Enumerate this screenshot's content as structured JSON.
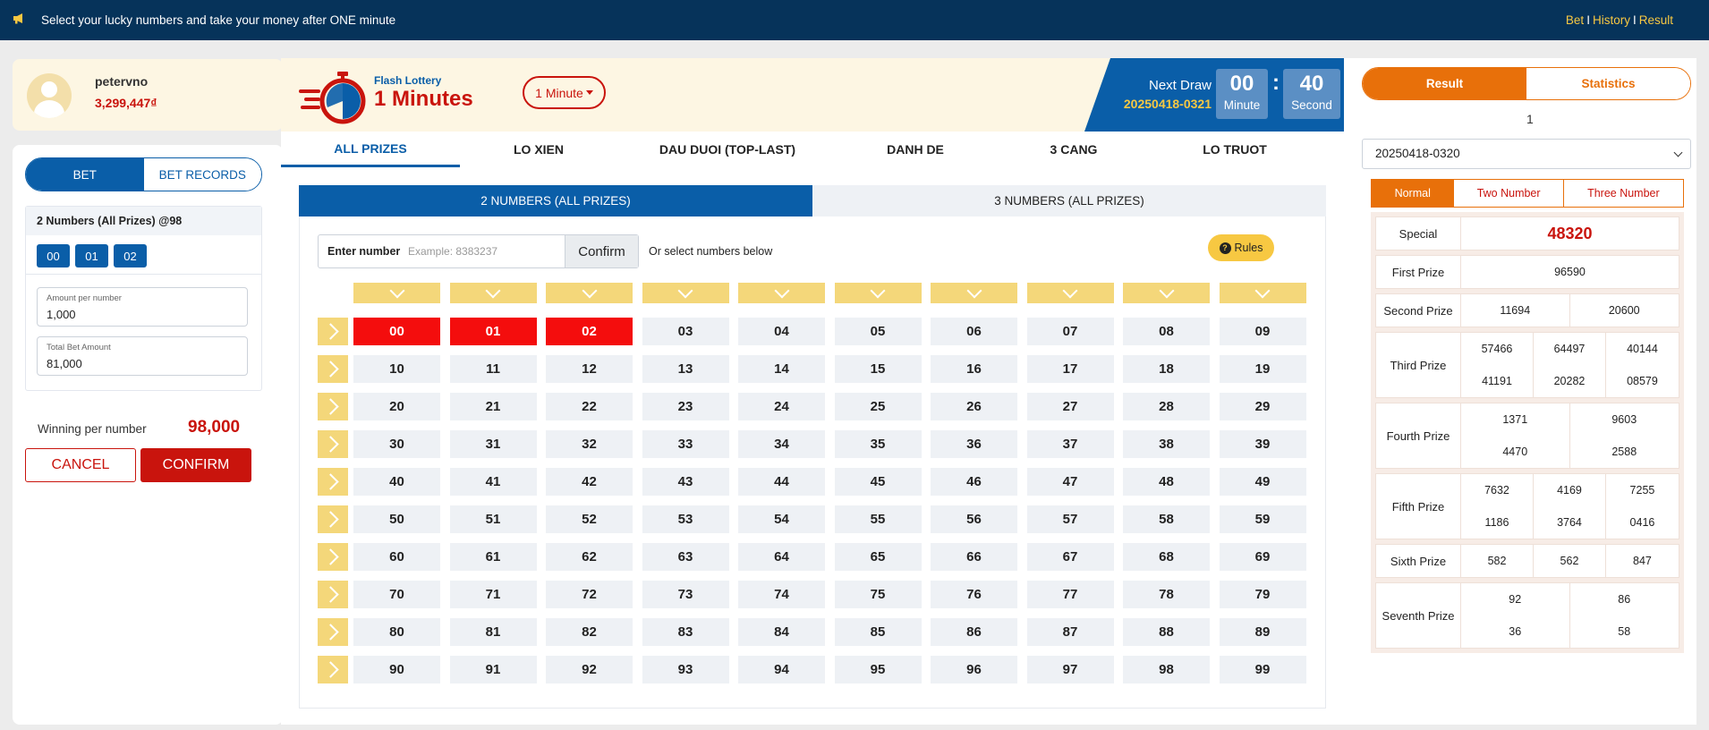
{
  "topbar": {
    "ticker": "Select your lucky numbers and take your money after ONE minute",
    "links": [
      "Bet",
      "History",
      "Result"
    ],
    "separator": "I"
  },
  "user": {
    "name": "petervno",
    "balance": "3,299,447₫"
  },
  "left": {
    "tabs": [
      "BET",
      "BET RECORDS"
    ],
    "bet_type": "2 Numbers (All Prizes) @98",
    "selected_numbers": [
      "00",
      "01",
      "02"
    ],
    "amount_per_number_label": "Amount per number",
    "amount_per_number": "1,000",
    "total_bet_label": "Total Bet Amount",
    "total_bet": "81,000",
    "winning_label": "Winning per number",
    "winning_value": "98,000",
    "cancel_label": "CANCEL",
    "confirm_label": "CONFIRM"
  },
  "game": {
    "subtitle": "Flash Lottery",
    "title": "1 Minutes",
    "period": "1 Minute",
    "next_draw_label": "Next Draw",
    "draw_id": "20250418-0321",
    "minutes": "00",
    "minute_label": "Minute",
    "seconds": "40",
    "second_label": "Second",
    "colon": ":"
  },
  "categories": [
    "ALL PRIZES",
    "LO XIEN",
    "DAU DUOI (TOP-LAST)",
    "DANH DE",
    "3 CANG",
    "LO TRUOT"
  ],
  "sub_tabs": [
    "2 NUMBERS (ALL PRIZES)",
    "3 NUMBERS (ALL PRIZES)"
  ],
  "entry": {
    "label": "Enter number",
    "placeholder": "Example: 8383237",
    "confirm": "Confirm",
    "or_text": "Or select numbers below",
    "rules": "Rules"
  },
  "grid": {
    "selected": [
      "00",
      "01",
      "02"
    ]
  },
  "result": {
    "tabs": [
      "Result",
      "Statistics"
    ],
    "count": "1",
    "draw_select": "20250418-0320",
    "modes": [
      "Normal",
      "Two Number",
      "Three Number"
    ],
    "prizes": [
      {
        "label": "Special",
        "values": [
          "48320"
        ]
      },
      {
        "label": "First Prize",
        "values": [
          "96590"
        ]
      },
      {
        "label": "Second Prize",
        "values": [
          "11694",
          "20600"
        ]
      },
      {
        "label": "Third Prize",
        "values": [
          "57466",
          "64497",
          "40144",
          "41191",
          "20282",
          "08579"
        ]
      },
      {
        "label": "Fourth Prize",
        "values": [
          "1371",
          "9603",
          "4470",
          "2588"
        ]
      },
      {
        "label": "Fifth Prize",
        "values": [
          "7632",
          "4169",
          "7255",
          "1186",
          "3764",
          "0416"
        ]
      },
      {
        "label": "Sixth Prize",
        "values": [
          "582",
          "562",
          "847"
        ]
      },
      {
        "label": "Seventh Prize",
        "values": [
          "92",
          "86",
          "36",
          "58"
        ]
      }
    ]
  },
  "colors": {
    "navy": "#06335a",
    "blue": "#0a5ea8",
    "red": "#c9140d",
    "orange": "#e8700a",
    "yellow": "#f4d77a"
  }
}
